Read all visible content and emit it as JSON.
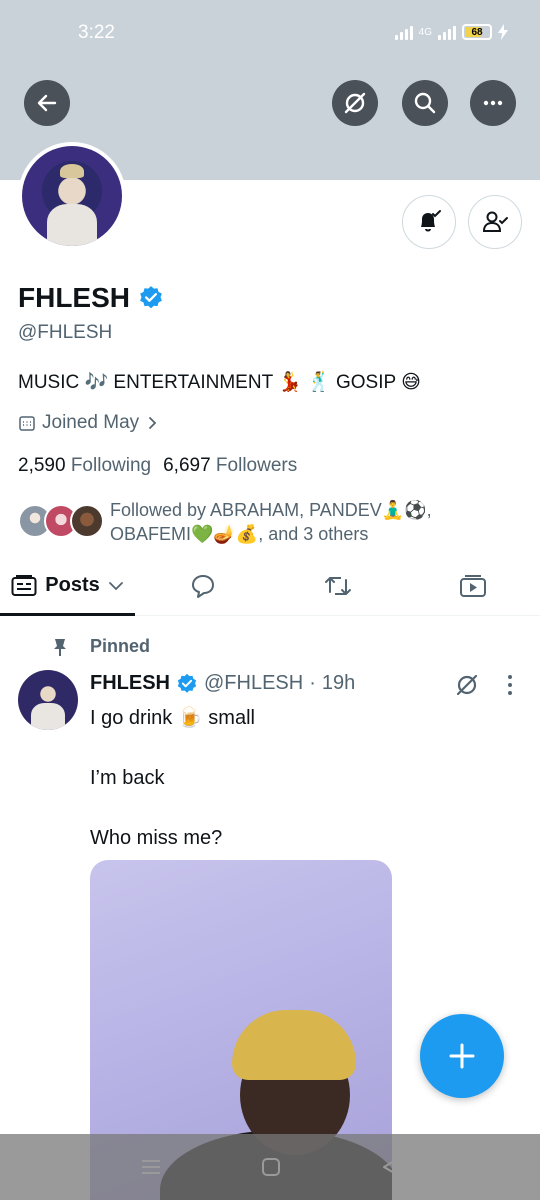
{
  "status_bar": {
    "time": "3:22",
    "network": "4G",
    "battery": "68"
  },
  "top_actions": {
    "back_icon": "arrow-left-icon",
    "grok_icon": "grok-slash-icon",
    "search_icon": "search-icon",
    "more_icon": "more-horizontal-icon"
  },
  "profile": {
    "name": "FHLESH",
    "handle": "@FHLESH",
    "bio": "MUSIC 🎶 ENTERTAINMENT 💃 🕺 GOSIP 😅",
    "joined": "Joined May",
    "following_count": "2,590",
    "following_label": "Following",
    "followers_count": "6,697",
    "followers_label": "Followers",
    "followed_by": "Followed by ABRAHAM, PANDEV🧘‍♂️⚽, OBAFEMI💚🪔💰, and 3 others"
  },
  "tabs": {
    "posts": "Posts"
  },
  "pinned_post": {
    "pinned_label": "Pinned",
    "author": "FHLESH",
    "handle": "@FHLESH",
    "separator": "·",
    "time": "19h",
    "text": "I go drink 🍺 small\n\nI’m back\n\nWho miss me?"
  },
  "colors": {
    "accent": "#1d9bf0",
    "header": "#c9d2d9",
    "secondary_text": "#536471"
  }
}
